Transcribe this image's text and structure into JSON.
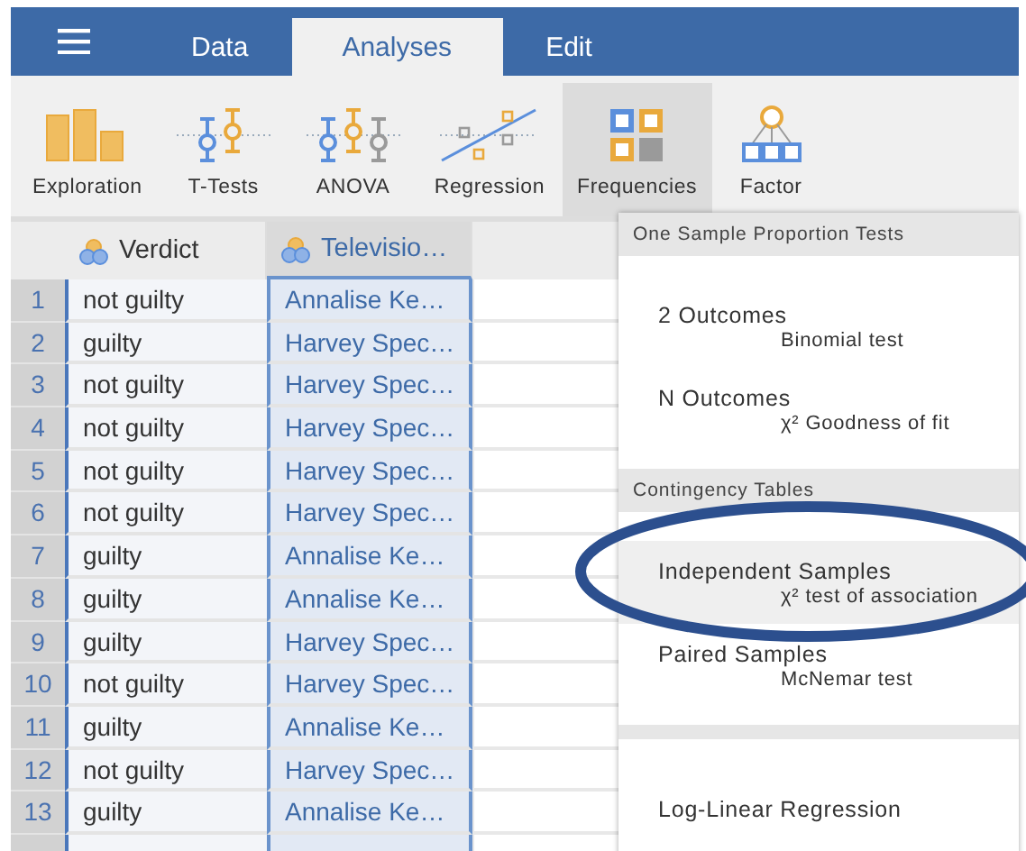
{
  "tabs": [
    {
      "label": "Data",
      "selected": false
    },
    {
      "label": "Analyses",
      "selected": true
    },
    {
      "label": "Edit",
      "selected": false
    }
  ],
  "ribbon": [
    {
      "label": "Exploration",
      "selected": false
    },
    {
      "label": "T-Tests",
      "selected": false
    },
    {
      "label": "ANOVA",
      "selected": false
    },
    {
      "label": "Regression",
      "selected": false
    },
    {
      "label": "Frequencies",
      "selected": true
    },
    {
      "label": "Factor",
      "selected": false
    }
  ],
  "table": {
    "columns": [
      {
        "name": "Verdict",
        "selected": false
      },
      {
        "name": "Televisio…",
        "selected": true
      }
    ],
    "rows": [
      {
        "number": "1",
        "cells": [
          "not guilty",
          "Annalise Ke…"
        ]
      },
      {
        "number": "2",
        "cells": [
          "guilty",
          "Harvey Spec…"
        ]
      },
      {
        "number": "3",
        "cells": [
          "not guilty",
          "Harvey Spec…"
        ]
      },
      {
        "number": "4",
        "cells": [
          "not guilty",
          "Harvey Spec…"
        ]
      },
      {
        "number": "5",
        "cells": [
          "not guilty",
          "Harvey Spec…"
        ]
      },
      {
        "number": "6",
        "cells": [
          "not guilty",
          "Harvey Spec…"
        ]
      },
      {
        "number": "7",
        "cells": [
          "guilty",
          "Annalise Ke…"
        ]
      },
      {
        "number": "8",
        "cells": [
          "guilty",
          "Annalise Ke…"
        ]
      },
      {
        "number": "9",
        "cells": [
          "guilty",
          "Harvey Spec…"
        ]
      },
      {
        "number": "10",
        "cells": [
          "not guilty",
          "Harvey Spec…"
        ]
      },
      {
        "number": "11",
        "cells": [
          "guilty",
          "Annalise Ke…"
        ]
      },
      {
        "number": "12",
        "cells": [
          "not guilty",
          "Harvey Spec…"
        ]
      },
      {
        "number": "13",
        "cells": [
          "guilty",
          "Annalise Ke…"
        ]
      }
    ]
  },
  "menu": {
    "sections": [
      {
        "heading": "One Sample Proportion Tests",
        "items": [
          {
            "title": "2 Outcomes",
            "subtitle": "Binomial test",
            "selected": false
          },
          {
            "title": "N Outcomes",
            "subtitle": "χ² Goodness of fit",
            "selected": false
          }
        ]
      },
      {
        "heading": "Contingency Tables",
        "items": [
          {
            "title": "Independent Samples",
            "subtitle": "χ² test of association",
            "selected": true
          },
          {
            "title": "Paired Samples",
            "subtitle": "McNemar test",
            "selected": false
          }
        ]
      },
      {
        "items": [
          {
            "title": "Log-Linear Regression",
            "selected": false
          }
        ]
      }
    ]
  },
  "annotation": {
    "kind": "ellipse"
  }
}
